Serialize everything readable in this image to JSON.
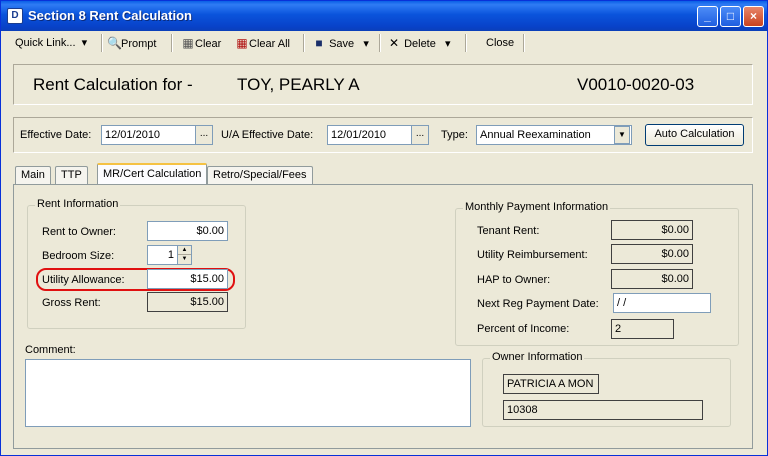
{
  "window": {
    "title": "Section 8 Rent Calculation",
    "icon": "app-icon",
    "controls": {
      "minimize": "_",
      "maximize": "□",
      "close": "×"
    }
  },
  "toolbar": {
    "quick_link": "Quick Link...",
    "prompt": "Prompt",
    "clear": "Clear",
    "clear_all": "Clear All",
    "save": "Save",
    "delete": "Delete",
    "close": "Close"
  },
  "header": {
    "label": "Rent Calculation for -",
    "tenant_name": "TOY, PEARLY A",
    "tenant_code": "V0010-0020-03"
  },
  "filters": {
    "effective_date_label": "Effective Date:",
    "effective_date": "12/01/2010",
    "ua_effective_date_label": "U/A Effective Date:",
    "ua_effective_date": "12/01/2010",
    "type_label": "Type:",
    "type_value": "Annual Reexamination",
    "auto_calc_button": "Auto Calculation",
    "ellipsis": "..."
  },
  "tabs": [
    {
      "label": "Main",
      "active": false
    },
    {
      "label": "TTP",
      "active": false
    },
    {
      "label": "MR/Cert Calculation",
      "active": true
    },
    {
      "label": "Retro/Special/Fees",
      "active": false
    }
  ],
  "rent_info": {
    "title": "Rent Information",
    "rent_to_owner_label": "Rent to Owner:",
    "rent_to_owner": "$0.00",
    "bedroom_size_label": "Bedroom Size:",
    "bedroom_size": "1",
    "utility_allowance_label": "Utility Allowance:",
    "utility_allowance": "$15.00",
    "gross_rent_label": "Gross Rent:",
    "gross_rent": "$15.00"
  },
  "payment_info": {
    "title": "Monthly Payment Information",
    "tenant_rent_label": "Tenant Rent:",
    "tenant_rent": "$0.00",
    "utility_reimb_label": "Utility Reimbursement:",
    "utility_reimb": "$0.00",
    "hap_label": "HAP to Owner:",
    "hap": "$0.00",
    "next_reg_label": "Next Reg Payment Date:",
    "next_reg": " / /",
    "percent_income_label": "Percent of Income:",
    "percent_income": "2"
  },
  "comment": {
    "label": "Comment:",
    "value": ""
  },
  "owner_info": {
    "title": "Owner Information",
    "name": "PATRICIA A MON",
    "code": "10308"
  },
  "colors": {
    "titlebar": "#0a54dc",
    "highlight": "#e01010",
    "window_bg": "#ece9d8"
  }
}
